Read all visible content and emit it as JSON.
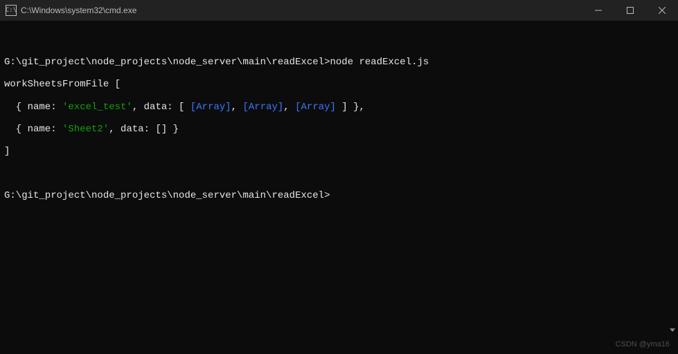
{
  "titlebar": {
    "icon_glyph": "C:\\",
    "title": "C:\\Windows\\system32\\cmd.exe"
  },
  "terminal": {
    "prompt1_path": "G:\\git_project\\node_projects\\node_server\\main\\readExcel>",
    "prompt1_cmd": "node readExcel.js",
    "out_line1": "workSheetsFromFile [",
    "out_row1_prefix": "  { name: ",
    "out_row1_name": "'excel_test'",
    "out_row1_mid": ", data: [ ",
    "out_row1_arr1": "[Array]",
    "out_row1_sep": ", ",
    "out_row1_arr2": "[Array]",
    "out_row1_arr3": "[Array]",
    "out_row1_suffix": " ] },",
    "out_row2_prefix": "  { name: ",
    "out_row2_name": "'Sheet2'",
    "out_row2_suffix": ", data: [] }",
    "out_close": "]",
    "prompt2_path": "G:\\git_project\\node_projects\\node_server\\main\\readExcel>"
  },
  "watermark": "CSDN @yma16"
}
